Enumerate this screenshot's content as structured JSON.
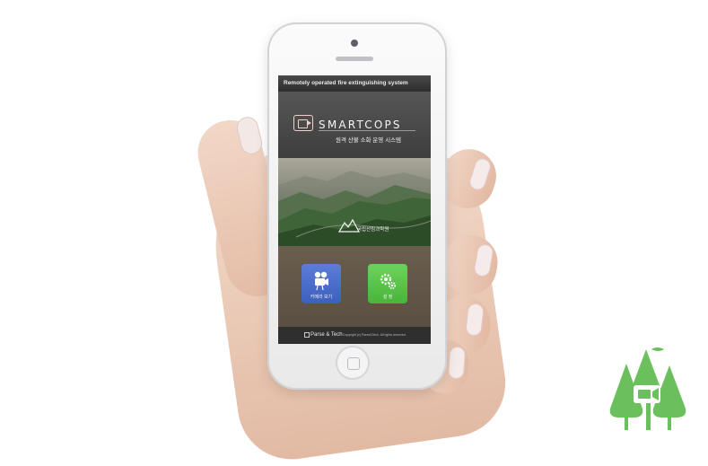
{
  "status_bar": {
    "title": "Remotely operated fire extinguishing system"
  },
  "brand": {
    "name": "SMARTCOPS",
    "subtitle": "원격 산불 소화 운영 시스템"
  },
  "banner": {
    "org_label": "국립산림과학원"
  },
  "menu": {
    "tiles": [
      {
        "label": "카메라 보기",
        "icon": "video-camera-icon",
        "color": "#4a6bc9"
      },
      {
        "label": "설 정",
        "icon": "gears-icon",
        "color": "#59c24a"
      }
    ]
  },
  "footer": {
    "brand": "Parse & Tech",
    "copyright": "Copyright (c) Parse&Tech. All rights reserved."
  },
  "colors": {
    "tree_green": "#6bbf5c",
    "tile_blue": "#4a6bc9",
    "tile_green": "#59c24a",
    "logo_pink": "#f1d2cb"
  }
}
